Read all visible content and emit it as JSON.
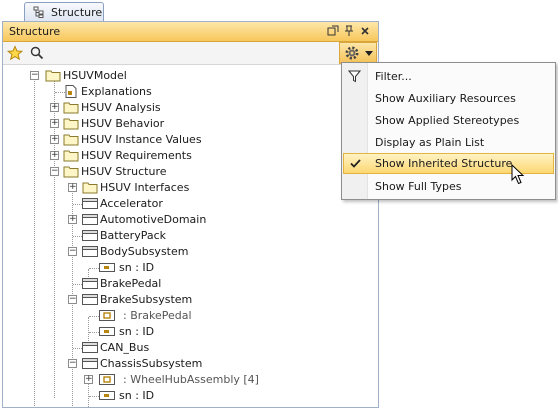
{
  "tab": {
    "label": "Structure"
  },
  "panel": {
    "title": "Structure"
  },
  "tree": [
    {
      "label": "HSUVModel",
      "icon": "folder"
    },
    {
      "label": "Explanations",
      "icon": "document"
    },
    {
      "label": "HSUV Analysis",
      "icon": "folder"
    },
    {
      "label": "HSUV Behavior",
      "icon": "folder"
    },
    {
      "label": "HSUV Instance Values",
      "icon": "folder"
    },
    {
      "label": "HSUV Requirements",
      "icon": "folder"
    },
    {
      "label": "HSUV Structure",
      "icon": "folder"
    },
    {
      "label": "HSUV Interfaces",
      "icon": "folder"
    },
    {
      "label": "Accelerator",
      "icon": "block"
    },
    {
      "label": "AutomotiveDomain",
      "icon": "block"
    },
    {
      "label": "BatteryPack",
      "icon": "block"
    },
    {
      "label": "BodySubsystem",
      "icon": "block"
    },
    {
      "label": "sn : ID",
      "icon": "property"
    },
    {
      "label": "BrakePedal",
      "icon": "block"
    },
    {
      "label": "BrakeSubsystem",
      "icon": "block"
    },
    {
      "label": ": BrakePedal",
      "icon": "part"
    },
    {
      "label": "sn : ID",
      "icon": "property"
    },
    {
      "label": "CAN_Bus",
      "icon": "block"
    },
    {
      "label": "ChassisSubsystem",
      "icon": "block"
    },
    {
      "label": ": WheelHubAssembly [4]",
      "icon": "part"
    },
    {
      "label": "sn : ID",
      "icon": "property"
    }
  ],
  "menu": {
    "items": [
      {
        "label": "Filter...",
        "icon": "filter-icon"
      },
      {
        "label": "Show Auxiliary Resources"
      },
      {
        "label": "Show Applied Stereotypes"
      },
      {
        "label": "Display as Plain List"
      },
      {
        "label": "Show Inherited Structure",
        "checked": true,
        "highlighted": true
      },
      {
        "label": "Show Full Types"
      }
    ]
  }
}
